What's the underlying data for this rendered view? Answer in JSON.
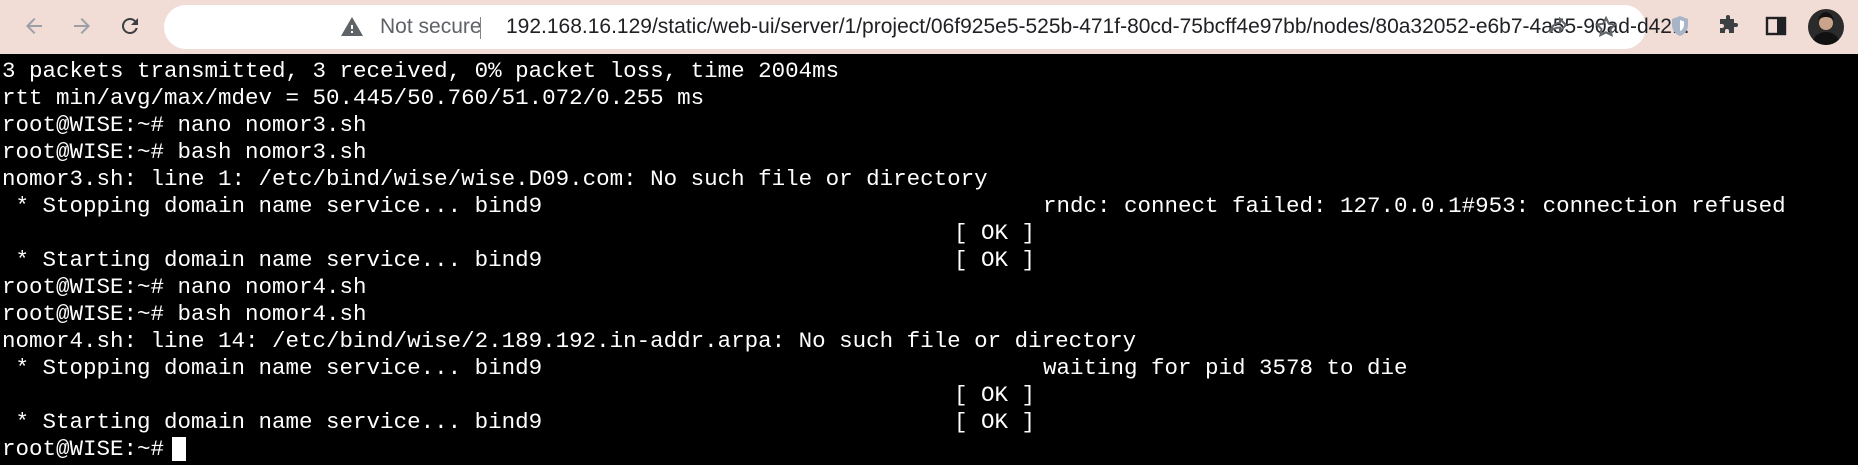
{
  "browser": {
    "security_label": "Not secure",
    "url": "192.168.16.129/static/web-ui/server/1/project/06f925e5-525b-471f-80cd-75bcff4e97bb/nodes/80a32052-e6b7-4a55-90ad-d42..."
  },
  "terminal": {
    "lines": [
      "3 packets transmitted, 3 received, 0% packet loss, time 2004ms",
      "rtt min/avg/max/mdev = 50.445/50.760/51.072/0.255 ms",
      "root@WISE:~# nano nomor3.sh",
      "root@WISE:~# bash nomor3.sh",
      "nomor3.sh: line 1: /etc/bind/wise/wise.D09.com: No such file or directory",
      " * Stopping domain name service... bind9",
      "",
      " * Starting domain name service... bind9",
      "root@WISE:~# nano nomor4.sh",
      "root@WISE:~# bash nomor4.sh",
      "nomor4.sh: line 14: /etc/bind/wise/2.189.192.in-addr.arpa: No such file or directory",
      " * Stopping domain name service... bind9",
      "",
      " * Starting domain name service... bind9",
      "root@WISE:~# "
    ],
    "right_messages": [
      "rndc: connect failed: 127.0.0.1#953: connection refused",
      "waiting for pid 3578 to die"
    ],
    "ok_label": "[ OK ]"
  }
}
